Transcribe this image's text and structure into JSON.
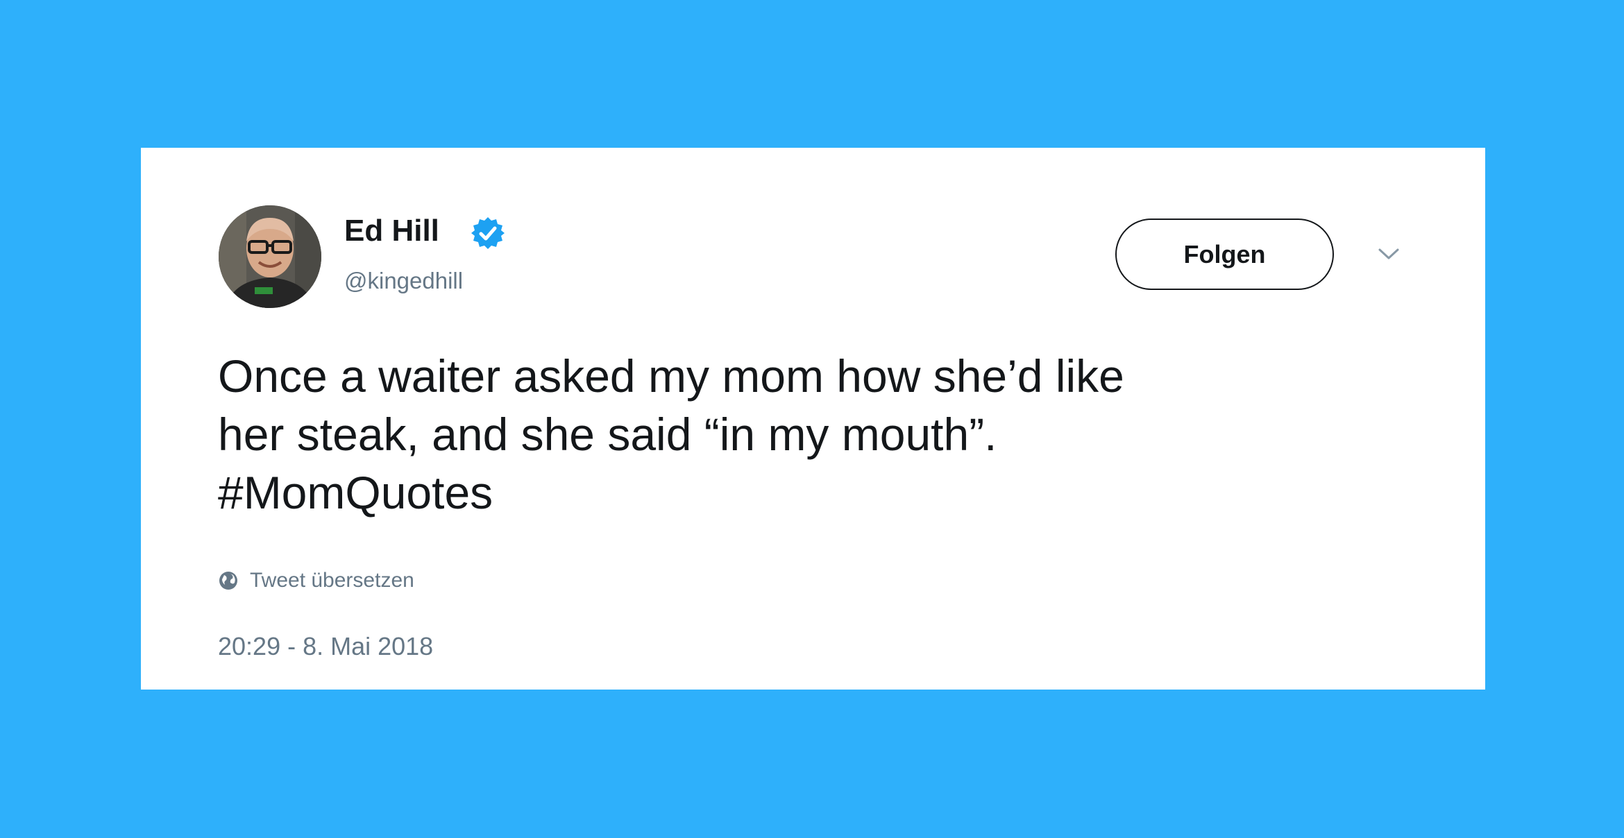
{
  "colors": {
    "page_background": "#2eb0fb",
    "card_background": "#ffffff",
    "text_primary": "#14171a",
    "text_secondary": "#657786",
    "verified_badge": "#1da1f2"
  },
  "author": {
    "display_name": "Ed Hill",
    "handle": "@kingedhill",
    "verified": true,
    "avatar_icon": "profile-photo"
  },
  "actions": {
    "follow_label": "Folgen",
    "menu_icon": "chevron-down-icon"
  },
  "tweet": {
    "text_lines": [
      "Once a waiter asked my mom how she’d like",
      "her steak, and she said “in my mouth”.",
      "#MomQuotes"
    ],
    "translate_label": "Tweet übersetzen",
    "translate_icon": "globe-icon",
    "timestamp": "20:29 - 8. Mai 2018"
  }
}
